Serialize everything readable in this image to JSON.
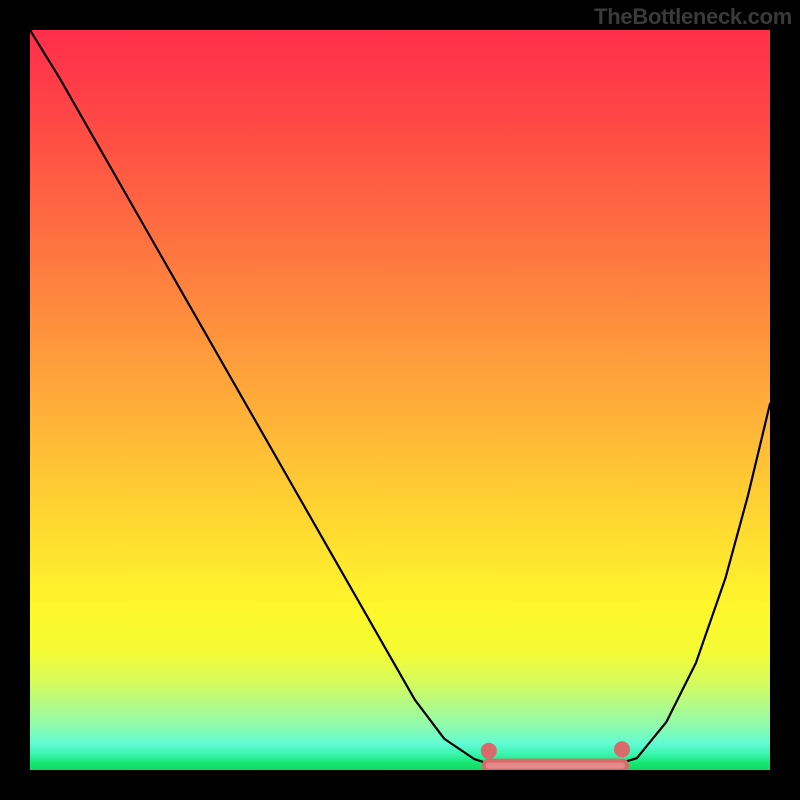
{
  "chart_data": {
    "type": "line",
    "title": "",
    "subtitle": "",
    "xlabel": "",
    "ylabel": "",
    "x_range": [
      0,
      100
    ],
    "y_range": [
      0,
      100
    ],
    "watermark": "TheBottleneck.com",
    "gradient": {
      "top_color": "#ff2f4b",
      "bottom_color": "#10d864",
      "description": "vertical gradient red→orange→yellow→green representing bottleneck severity"
    },
    "series": [
      {
        "name": "bottleneck-curve",
        "x": [
          0,
          4,
          8,
          12,
          16,
          20,
          24,
          28,
          32,
          36,
          40,
          44,
          48,
          52,
          56,
          60,
          63,
          66,
          70,
          74,
          78,
          82,
          86,
          90,
          94,
          97,
          100
        ],
        "y": [
          100,
          93.5,
          86.5,
          79.5,
          72.5,
          65.5,
          58.5,
          51.5,
          44.5,
          37.5,
          30.5,
          23.5,
          16.5,
          9.5,
          4.2,
          1.5,
          0.5,
          0.3,
          0.3,
          0.3,
          0.4,
          1.6,
          6.5,
          14.5,
          26,
          37,
          49.5
        ]
      }
    ],
    "flat_minimum": {
      "x_start": 62,
      "x_end": 80,
      "y": 0.6,
      "description": "flat region near the minimum highlighted with a muted red band and end dots"
    },
    "annotations": []
  }
}
